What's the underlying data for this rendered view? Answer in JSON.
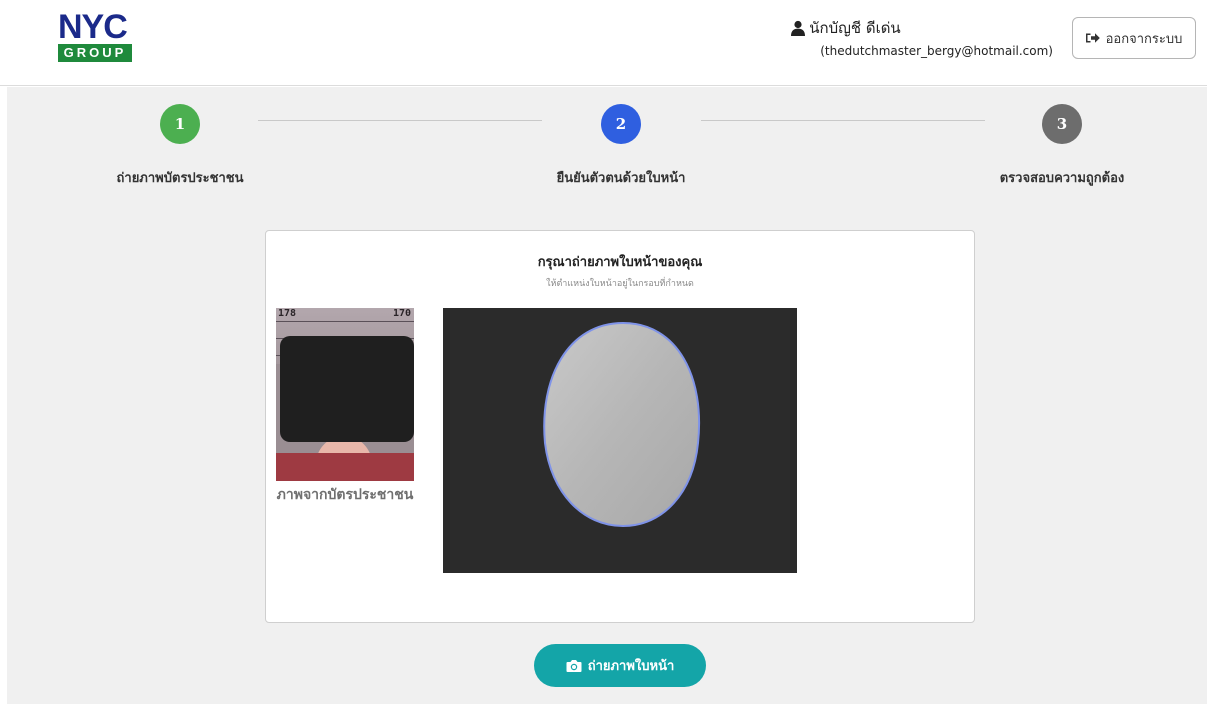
{
  "header": {
    "logo_top": "NYC",
    "logo_bottom": "GROUP",
    "user_name": "นักบัญชี ดีเด่น",
    "user_email": "(thedutchmaster_bergy@hotmail.com)",
    "logout_label": "ออกจากระบบ"
  },
  "steps": [
    {
      "number": "1",
      "label": "ถ่ายภาพบัตรประชาชน",
      "color": "#4caf50",
      "status": "done"
    },
    {
      "number": "2",
      "label": "ยืนยันตัวตนด้วยใบหน้า",
      "color": "#2f5fe0",
      "status": "current"
    },
    {
      "number": "3",
      "label": "ตรวจสอบความถูกต้อง",
      "color": "#6d6d6d",
      "status": "pending"
    }
  ],
  "card": {
    "title": "กรุณาถ่ายภาพใบหน้าของคุณ",
    "subtitle": "ให้ตำแหน่งใบหน้าอยู่ในกรอบที่กำหนด",
    "id_caption": "ภาพจากบัตรประชาชน",
    "ruler_left": "178",
    "ruler_right": "170"
  },
  "capture_button": {
    "label": "ถ่ายภาพใบหน้า",
    "color": "#14a5a8"
  },
  "icons": {
    "user": "user-icon",
    "logout": "sign-out-icon",
    "camera": "camera-icon"
  }
}
